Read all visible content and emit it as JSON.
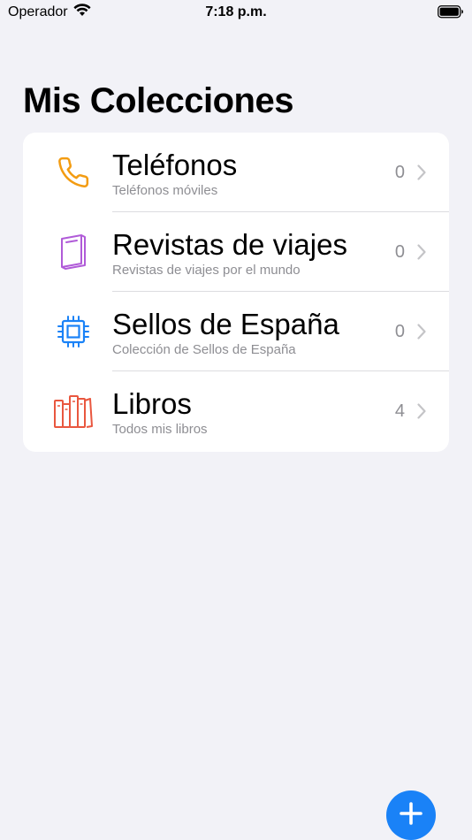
{
  "status_bar": {
    "carrier": "Operador",
    "time": "7:18 p.m."
  },
  "page": {
    "title": "Mis Colecciones"
  },
  "collections": [
    {
      "title": "Teléfonos",
      "subtitle": "Teléfonos móviles",
      "count": "0",
      "icon": "phone-icon",
      "color": "#f39c12"
    },
    {
      "title": "Revistas de viajes",
      "subtitle": "Revistas de viajes por el mundo",
      "count": "0",
      "icon": "magazine-icon",
      "color": "#b05bd8"
    },
    {
      "title": "Sellos de España",
      "subtitle": "Colección de Sellos de España",
      "count": "0",
      "icon": "stamp-chip-icon",
      "color": "#1a82f7"
    },
    {
      "title": "Libros",
      "subtitle": "Todos mis libros",
      "count": "4",
      "icon": "books-icon",
      "color": "#e9573f"
    }
  ],
  "fab": {
    "icon": "plus-icon",
    "color": "#1a82f7"
  }
}
